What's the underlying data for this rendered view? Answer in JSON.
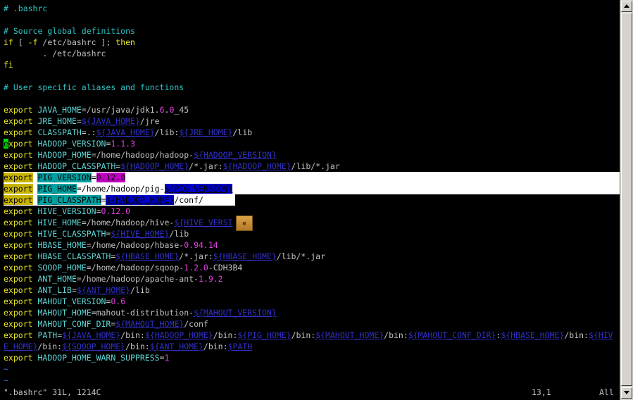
{
  "editor": {
    "lines": [
      [
        [
          "c",
          "# .bashrc"
        ]
      ],
      [],
      [
        [
          "c",
          "# Source global definitions"
        ]
      ],
      [
        [
          "k",
          "if"
        ],
        [
          "p",
          " [ "
        ],
        [
          "k",
          "-f"
        ],
        [
          "p",
          " /etc/bashrc ]; "
        ],
        [
          "k",
          "then"
        ]
      ],
      [
        [
          "p",
          "        . /etc/bashrc"
        ]
      ],
      [
        [
          "k",
          "fi"
        ]
      ],
      [],
      [
        [
          "c",
          "# User specific aliases and functions"
        ]
      ],
      [],
      [
        [
          "k",
          "export"
        ],
        [
          "p",
          " "
        ],
        [
          "i",
          "JAVA_HOME"
        ],
        [
          "p",
          "=/usr/java/jdk1."
        ],
        [
          "n",
          "6"
        ],
        [
          "p",
          "."
        ],
        [
          "n",
          "0"
        ],
        [
          "p",
          "_45"
        ]
      ],
      [
        [
          "k",
          "export"
        ],
        [
          "p",
          " "
        ],
        [
          "i",
          "JRE_HOME"
        ],
        [
          "p",
          "="
        ],
        [
          "v",
          "${JAVA_HOME}"
        ],
        [
          "p",
          "/jre"
        ]
      ],
      [
        [
          "k",
          "export"
        ],
        [
          "p",
          " "
        ],
        [
          "i",
          "CLASSPATH"
        ],
        [
          "p",
          "=.:"
        ],
        [
          "v",
          "${JAVA_HOME}"
        ],
        [
          "p",
          "/lib:"
        ],
        [
          "v",
          "${JRE_HOME}"
        ],
        [
          "p",
          "/lib"
        ]
      ],
      [
        [
          "cur",
          "e"
        ],
        [
          "k",
          "xport"
        ],
        [
          "p",
          " "
        ],
        [
          "i",
          "HADOOP_VERSION"
        ],
        [
          "p",
          "="
        ],
        [
          "n",
          "1.1.3"
        ]
      ],
      [
        [
          "k",
          "export"
        ],
        [
          "p",
          " "
        ],
        [
          "i",
          "HADOOP_HOME"
        ],
        [
          "p",
          "=/home/hadoop/hadoop-"
        ],
        [
          "v",
          "${HADOOP_VERSION}"
        ]
      ],
      [
        [
          "k",
          "export"
        ],
        [
          "p",
          " "
        ],
        [
          "i",
          "HADOOP_CLASSPATH"
        ],
        [
          "p",
          "="
        ],
        [
          "v",
          "${HADOOP_HOME}"
        ],
        [
          "p",
          "/*.jar:"
        ],
        [
          "v",
          "${HADOOP_HOME}"
        ],
        [
          "p",
          "/lib/*.jar"
        ]
      ],
      [
        [
          "k",
          "export"
        ],
        [
          "p",
          " "
        ],
        [
          "i",
          "PIG_VERSION"
        ],
        [
          "p",
          "="
        ],
        [
          "n",
          "0.12.0"
        ]
      ],
      [
        [
          "k",
          "export"
        ],
        [
          "p",
          " "
        ],
        [
          "i",
          "PIG_HOME"
        ],
        [
          "p",
          "=/home/hadoop/pig-"
        ],
        [
          "v",
          "${PIG_VERSION}"
        ]
      ],
      [
        [
          "k",
          "export"
        ],
        [
          "p",
          " "
        ],
        [
          "i",
          "PIG_CLASSPATH"
        ],
        [
          "p",
          "="
        ],
        [
          "v",
          "${HADOOP_HOME}"
        ],
        [
          "p",
          "/conf/"
        ]
      ],
      [
        [
          "k",
          "export"
        ],
        [
          "p",
          " "
        ],
        [
          "i",
          "HIVE_VERSION"
        ],
        [
          "p",
          "="
        ],
        [
          "n",
          "0.12.0"
        ]
      ],
      [
        [
          "k",
          "export"
        ],
        [
          "p",
          " "
        ],
        [
          "i",
          "HIVE_HOME"
        ],
        [
          "p",
          "=/home/hadoop/hive-"
        ],
        [
          "v",
          "${HIVE_VERSI"
        ]
      ],
      [
        [
          "k",
          "export"
        ],
        [
          "p",
          " "
        ],
        [
          "i",
          "HIVE_CLASSPATH"
        ],
        [
          "p",
          "="
        ],
        [
          "v",
          "${HIVE_HOME}"
        ],
        [
          "p",
          "/lib"
        ]
      ],
      [
        [
          "k",
          "export"
        ],
        [
          "p",
          " "
        ],
        [
          "i",
          "HBASE_HOME"
        ],
        [
          "p",
          "=/home/hadoop/hbase-"
        ],
        [
          "n",
          "0.94.14"
        ]
      ],
      [
        [
          "k",
          "export"
        ],
        [
          "p",
          " "
        ],
        [
          "i",
          "HBASE_CLASSPATH"
        ],
        [
          "p",
          "="
        ],
        [
          "v",
          "${HBASE_HOME}"
        ],
        [
          "p",
          "/*.jar:"
        ],
        [
          "v",
          "${HBASE_HOME}"
        ],
        [
          "p",
          "/lib/*.jar"
        ]
      ],
      [
        [
          "k",
          "export"
        ],
        [
          "p",
          " "
        ],
        [
          "i",
          "SQOOP_HOME"
        ],
        [
          "p",
          "=/home/hadoop/sqoop-"
        ],
        [
          "n",
          "1.2.0"
        ],
        [
          "p",
          "-CDH3B4"
        ]
      ],
      [
        [
          "k",
          "export"
        ],
        [
          "p",
          " "
        ],
        [
          "i",
          "ANT_HOME"
        ],
        [
          "p",
          "=/home/hadoop/apache-ant-"
        ],
        [
          "n",
          "1.9.2"
        ]
      ],
      [
        [
          "k",
          "export"
        ],
        [
          "p",
          " "
        ],
        [
          "i",
          "ANT_LIB"
        ],
        [
          "p",
          "="
        ],
        [
          "v",
          "${ANT_HOME}"
        ],
        [
          "p",
          "/lib"
        ]
      ],
      [
        [
          "k",
          "export"
        ],
        [
          "p",
          " "
        ],
        [
          "i",
          "MAHOUT_VERSION"
        ],
        [
          "p",
          "="
        ],
        [
          "n",
          "0.6"
        ]
      ],
      [
        [
          "k",
          "export"
        ],
        [
          "p",
          " "
        ],
        [
          "i",
          "MAHOUT_HOME"
        ],
        [
          "p",
          "=mahout-distribution-"
        ],
        [
          "v",
          "${MAHOUT_VERSION}"
        ]
      ],
      [
        [
          "k",
          "export"
        ],
        [
          "p",
          " "
        ],
        [
          "i",
          "MAHOUT_CONF_DIR"
        ],
        [
          "p",
          "="
        ],
        [
          "v",
          "${MAHOUT_HOME}"
        ],
        [
          "p",
          "/conf"
        ]
      ],
      [
        [
          "k",
          "export"
        ],
        [
          "p",
          " "
        ],
        [
          "i",
          "PATH"
        ],
        [
          "p",
          "="
        ],
        [
          "v",
          "${JAVA_HOME}"
        ],
        [
          "p",
          "/bin:"
        ],
        [
          "v",
          "${HADOOP_HOME}"
        ],
        [
          "p",
          "/bin:"
        ],
        [
          "v",
          "${PIG_HOME}"
        ],
        [
          "p",
          "/bin:"
        ],
        [
          "v",
          "${MAHOUT_HOME}"
        ],
        [
          "p",
          "/bin:"
        ],
        [
          "v",
          "${MAHOUT_CONF_DIR}"
        ],
        [
          "p",
          ":"
        ],
        [
          "v",
          "${HBASE_HOME}"
        ],
        [
          "p",
          "/bin:"
        ],
        [
          "v",
          "${HIV"
        ]
      ],
      [
        [
          "v",
          "E_HOME}"
        ],
        [
          "p",
          "/bin:"
        ],
        [
          "v",
          "${SQOOP_HOME}"
        ],
        [
          "p",
          "/bin:"
        ],
        [
          "v",
          "${ANT_HOME}"
        ],
        [
          "p",
          "/bin:"
        ],
        [
          "v",
          "$PATH"
        ]
      ],
      [
        [
          "k",
          "export"
        ],
        [
          "p",
          " "
        ],
        [
          "i",
          "HADOOP_HOME_WARN_SUPPRESS"
        ],
        [
          "p",
          "="
        ],
        [
          "n",
          "1"
        ]
      ],
      [
        [
          "t",
          "~"
        ]
      ],
      [
        [
          "t",
          "~"
        ]
      ]
    ]
  },
  "status_bar": {
    "file_info": "\".bashrc\" 31L, 1214C",
    "position": "13,1",
    "scroll": "All"
  },
  "colors": {
    "selection_line": "#ffffff",
    "selection_partial": "#ffffff",
    "cursor": "#00e000"
  }
}
